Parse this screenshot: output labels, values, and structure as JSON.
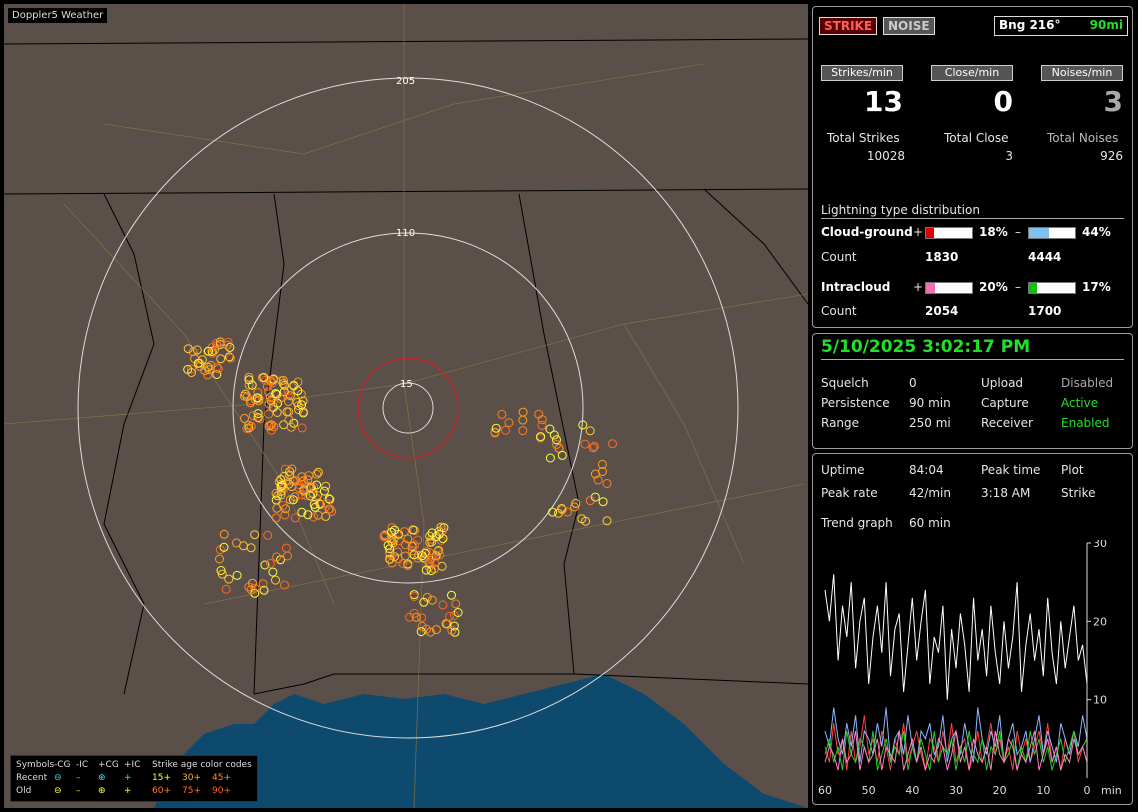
{
  "map": {
    "title": "Doppler5 Weather",
    "ring_labels": [
      "205",
      "110",
      "15"
    ]
  },
  "legend": {
    "head": [
      "Symbols",
      "-CG",
      "-IC",
      "+CG",
      "+IC",
      "Strike age color codes"
    ],
    "recent_label": "Recent",
    "old_label": "Old",
    "recent_ages": [
      "15+",
      "30+",
      "45+"
    ],
    "old_ages": [
      "60+",
      "75+",
      "90+"
    ]
  },
  "status": {
    "strike_label": "STRIKE",
    "noise_label": "NOISE",
    "bearing": "Bng 216°",
    "distance": "90mi"
  },
  "rates": {
    "strikes_label": "Strikes/min",
    "close_label": "Close/min",
    "noises_label": "Noises/min",
    "strikes": "13",
    "close": "0",
    "noises": "3",
    "total_strikes_label": "Total Strikes",
    "total_close_label": "Total Close",
    "total_noises_label": "Total Noises",
    "total_strikes": "10028",
    "total_close": "3",
    "total_noises": "926"
  },
  "distribution": {
    "title": "Lightning type distribution",
    "cg_label": "Cloud-ground",
    "ic_label": "Intracloud",
    "count_label": "Count",
    "plus": "+",
    "minus": "–",
    "cg_pos_pct": "18%",
    "cg_neg_pct": "44%",
    "cg_pos_count": "1830",
    "cg_neg_count": "4444",
    "ic_pos_pct": "20%",
    "ic_neg_pct": "17%",
    "ic_pos_count": "2054",
    "ic_neg_count": "1700",
    "cg_pos_frac": 0.18,
    "cg_neg_frac": 0.44,
    "ic_pos_frac": 0.2,
    "ic_neg_frac": 0.17,
    "colors": {
      "cg_pos": "#e00000",
      "cg_neg": "#7fc1f0",
      "ic_pos": "#f070b0",
      "ic_neg": "#10c010"
    }
  },
  "settings": {
    "datetime": "5/10/2025 3:02:17 PM",
    "squelch_label": "Squelch",
    "squelch": "0",
    "upload_label": "Upload",
    "upload": "Disabled",
    "persistence_label": "Persistence",
    "persistence": "90 min",
    "capture_label": "Capture",
    "capture": "Active",
    "range_label": "Range",
    "range": "250 mi",
    "receiver_label": "Receiver",
    "receiver": "Enabled"
  },
  "stats": {
    "uptime_label": "Uptime",
    "uptime": "84:04",
    "peak_time_label": "Peak time",
    "peak_time": "3:18 AM",
    "plot_label": "Plot",
    "plot": "Strike",
    "peak_rate_label": "Peak rate",
    "peak_rate": "42/min",
    "trend_label": "Trend graph",
    "trend": "60 min"
  },
  "chart_data": {
    "type": "line",
    "x_ticks": [
      "60",
      "50",
      "40",
      "30",
      "20",
      "10",
      "0"
    ],
    "x_unit": "min",
    "y_ticks": [
      "30",
      "20",
      "10"
    ],
    "ylim": [
      0,
      30
    ],
    "xlim": [
      60,
      0
    ],
    "series": [
      {
        "color": "#ffffff",
        "values": [
          24,
          20,
          26,
          15,
          22,
          18,
          25,
          14,
          20,
          23,
          12,
          18,
          22,
          16,
          25,
          13,
          19,
          21,
          11,
          17,
          23,
          15,
          20,
          24,
          12,
          18,
          16,
          22,
          10,
          19,
          14,
          21,
          17,
          11,
          23,
          15,
          19,
          13,
          22,
          16,
          12,
          20,
          14,
          18,
          25,
          11,
          17,
          21,
          15,
          19,
          13,
          23,
          16,
          12,
          20,
          14,
          18,
          22,
          15,
          17,
          12
        ]
      },
      {
        "color": "#ff4040",
        "values": [
          4,
          2,
          7,
          3,
          5,
          1,
          6,
          2,
          4,
          8,
          3,
          5,
          2,
          6,
          4,
          1,
          5,
          3,
          7,
          2,
          4,
          6,
          3,
          1,
          5,
          4,
          2,
          6,
          3,
          7,
          2,
          4,
          5,
          1,
          3,
          6,
          2,
          4,
          7,
          3,
          5,
          2,
          4,
          1,
          6,
          3,
          5,
          2,
          4,
          6,
          3,
          7,
          2,
          4,
          1,
          5,
          3,
          6,
          2,
          4,
          5
        ]
      },
      {
        "color": "#8ab8ff",
        "values": [
          6,
          4,
          9,
          5,
          3,
          7,
          4,
          8,
          2,
          6,
          5,
          3,
          7,
          4,
          9,
          2,
          5,
          6,
          3,
          8,
          4,
          2,
          6,
          5,
          7,
          3,
          4,
          8,
          2,
          5,
          6,
          3,
          7,
          4,
          2,
          9,
          5,
          3,
          6,
          4,
          8,
          2,
          5,
          7,
          3,
          4,
          6,
          2,
          5,
          8,
          3,
          6,
          4,
          2,
          7,
          5,
          3,
          6,
          4,
          8,
          5
        ]
      },
      {
        "color": "#20d020",
        "values": [
          3,
          5,
          2,
          4,
          1,
          6,
          3,
          2,
          5,
          4,
          2,
          6,
          1,
          3,
          5,
          2,
          4,
          3,
          6,
          1,
          4,
          2,
          5,
          3,
          1,
          6,
          2,
          4,
          3,
          5,
          1,
          4,
          2,
          6,
          3,
          2,
          5,
          1,
          4,
          3,
          6,
          2,
          3,
          5,
          1,
          4,
          2,
          6,
          3,
          5,
          2,
          4,
          1,
          3,
          5,
          2,
          4,
          6,
          3,
          4,
          5
        ]
      },
      {
        "color": "#ff80c0",
        "values": [
          2,
          4,
          3,
          1,
          5,
          2,
          3,
          6,
          1,
          4,
          2,
          3,
          5,
          1,
          4,
          3,
          2,
          6,
          1,
          3,
          5,
          2,
          4,
          1,
          3,
          2,
          5,
          4,
          1,
          3,
          6,
          2,
          4,
          1,
          5,
          3,
          2,
          4,
          1,
          6,
          3,
          2,
          5,
          4,
          1,
          3,
          2,
          4,
          6,
          1,
          3,
          5,
          2,
          4,
          1,
          3,
          2,
          5,
          3,
          4,
          2
        ]
      }
    ]
  }
}
